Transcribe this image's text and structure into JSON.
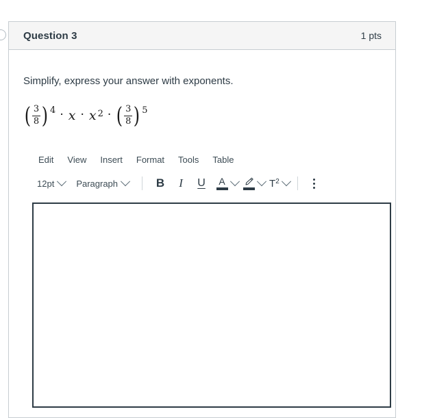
{
  "question": {
    "title": "Question 3",
    "points": "1 pts",
    "prompt": "Simplify, express your answer with exponents.",
    "expression": {
      "text": "(3/8)^4 · x · x^2 · (3/8)^5",
      "term1": {
        "numerator": "3",
        "denominator": "8",
        "exponent": "4"
      },
      "operator1": "·",
      "term2": "x",
      "operator2": "·",
      "term3": {
        "base": "x",
        "exponent": "2"
      },
      "operator3": "·",
      "term4": {
        "numerator": "3",
        "denominator": "8",
        "exponent": "5"
      },
      "paren_open": "(",
      "paren_close": ")"
    }
  },
  "editor": {
    "menubar": [
      {
        "label": "Edit"
      },
      {
        "label": "View"
      },
      {
        "label": "Insert"
      },
      {
        "label": "Format"
      },
      {
        "label": "Tools"
      },
      {
        "label": "Table"
      }
    ],
    "toolbar": {
      "font_size": "12pt",
      "block_format": "Paragraph",
      "bold_label": "B",
      "italic_label": "I",
      "underline_label": "U",
      "text_color_glyph": "A",
      "highlight_glyph": "✎",
      "superscript_base": "T",
      "superscript_exp": "2"
    },
    "content": ""
  },
  "colors": {
    "card_border": "#c7cdd1",
    "header_bg": "#f5f5f5",
    "text": "#2d3b45",
    "editor_focus_border": "#2d3b45"
  }
}
